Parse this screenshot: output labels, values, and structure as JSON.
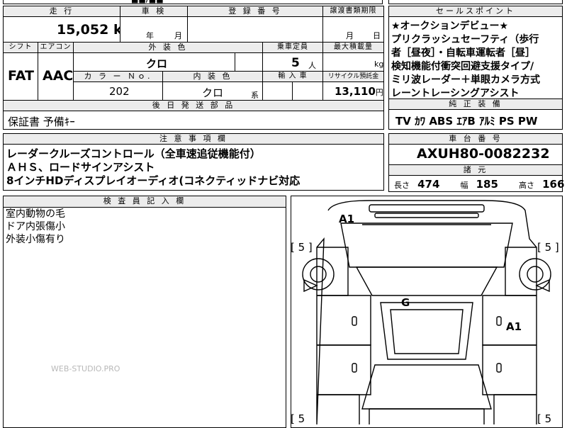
{
  "top_strip": {
    "partial_text": "■■/■■"
  },
  "mileage": {
    "header": "走 行",
    "value": "15,052",
    "unit": "km"
  },
  "inspection": {
    "header": "車 検",
    "year_label": "年",
    "month_label": "月"
  },
  "registration": {
    "header": "登 録 番 号"
  },
  "transfer_deadline": {
    "header": "譲渡書類期限",
    "month_label": "月",
    "day_label": "日"
  },
  "sales_points": {
    "header": "セールスポイント",
    "lines": [
      "★オークションデビュー★",
      "プリクラッシュセーフティ（歩行",
      "者［昼夜］・自転車運転者［昼］",
      "検知機能付衝突回避支援タイプ/",
      "ミリ波レーダー＋単眼カメラ方式",
      "レーントレーシングアシスト"
    ]
  },
  "shift": {
    "header": "シフト",
    "value": "FAT"
  },
  "aircon": {
    "header": "エアコン",
    "value": "AAC"
  },
  "exterior_color": {
    "header": "外 装 色",
    "value": "クロ"
  },
  "capacity": {
    "header": "乗車定員",
    "value": "5",
    "unit": "人"
  },
  "max_load": {
    "header": "最大積載量",
    "unit": "kg"
  },
  "color_no": {
    "header": "カ ラ ー Ｎｏ.",
    "value": "202"
  },
  "interior_color": {
    "header": "内 装 色",
    "value": "クロ",
    "suffix": "系"
  },
  "import": {
    "header": "輸 入 車"
  },
  "recycle": {
    "header": "リサイクル預託金",
    "value": "13,110",
    "unit": "円"
  },
  "later_parts": {
    "header": "後 日 発 送 部 品",
    "value": "保証書 予備ｷｰ"
  },
  "genuine_equipment": {
    "header": "純 正 装 備",
    "items": [
      "TV",
      "ｶﾜ",
      "ABS",
      "ｴｱB",
      "ｱﾙﾐ",
      "PS",
      "PW"
    ]
  },
  "notes": {
    "header": "注 意 事 項 欄",
    "lines": [
      "レーダークルーズコントロール（全車速追従機能付）",
      "ＡＨＳ、ロードサインアシスト",
      "8インチHDディスプレイオーディオ(コネクティッドナビ対応"
    ]
  },
  "chassis": {
    "header": "車 台 番 号",
    "value": "AXUH80-0082232"
  },
  "dimensions": {
    "header": "諸 元",
    "length_label": "長さ",
    "length": "474",
    "width_label": "幅",
    "width": "185",
    "height_label": "高さ",
    "height": "166"
  },
  "inspector": {
    "header": "検 査 員 記 入 欄",
    "lines": [
      "室内動物の毛",
      "ドア内張傷小",
      "外装小傷有り"
    ]
  },
  "watermark": "WEB-STUDIO.PRO",
  "diagram": {
    "marks": {
      "front": "A1",
      "center": "G",
      "right": "A1"
    },
    "tire_left_top": "[ 5 ]",
    "tire_right_top": "[ 5 ]",
    "tire_left_bottom": "[ 5",
    "tire_right_bottom": "[ 5"
  },
  "colors": {
    "border": "#000000",
    "header_bg": "#ececec",
    "background": "#ffffff"
  }
}
